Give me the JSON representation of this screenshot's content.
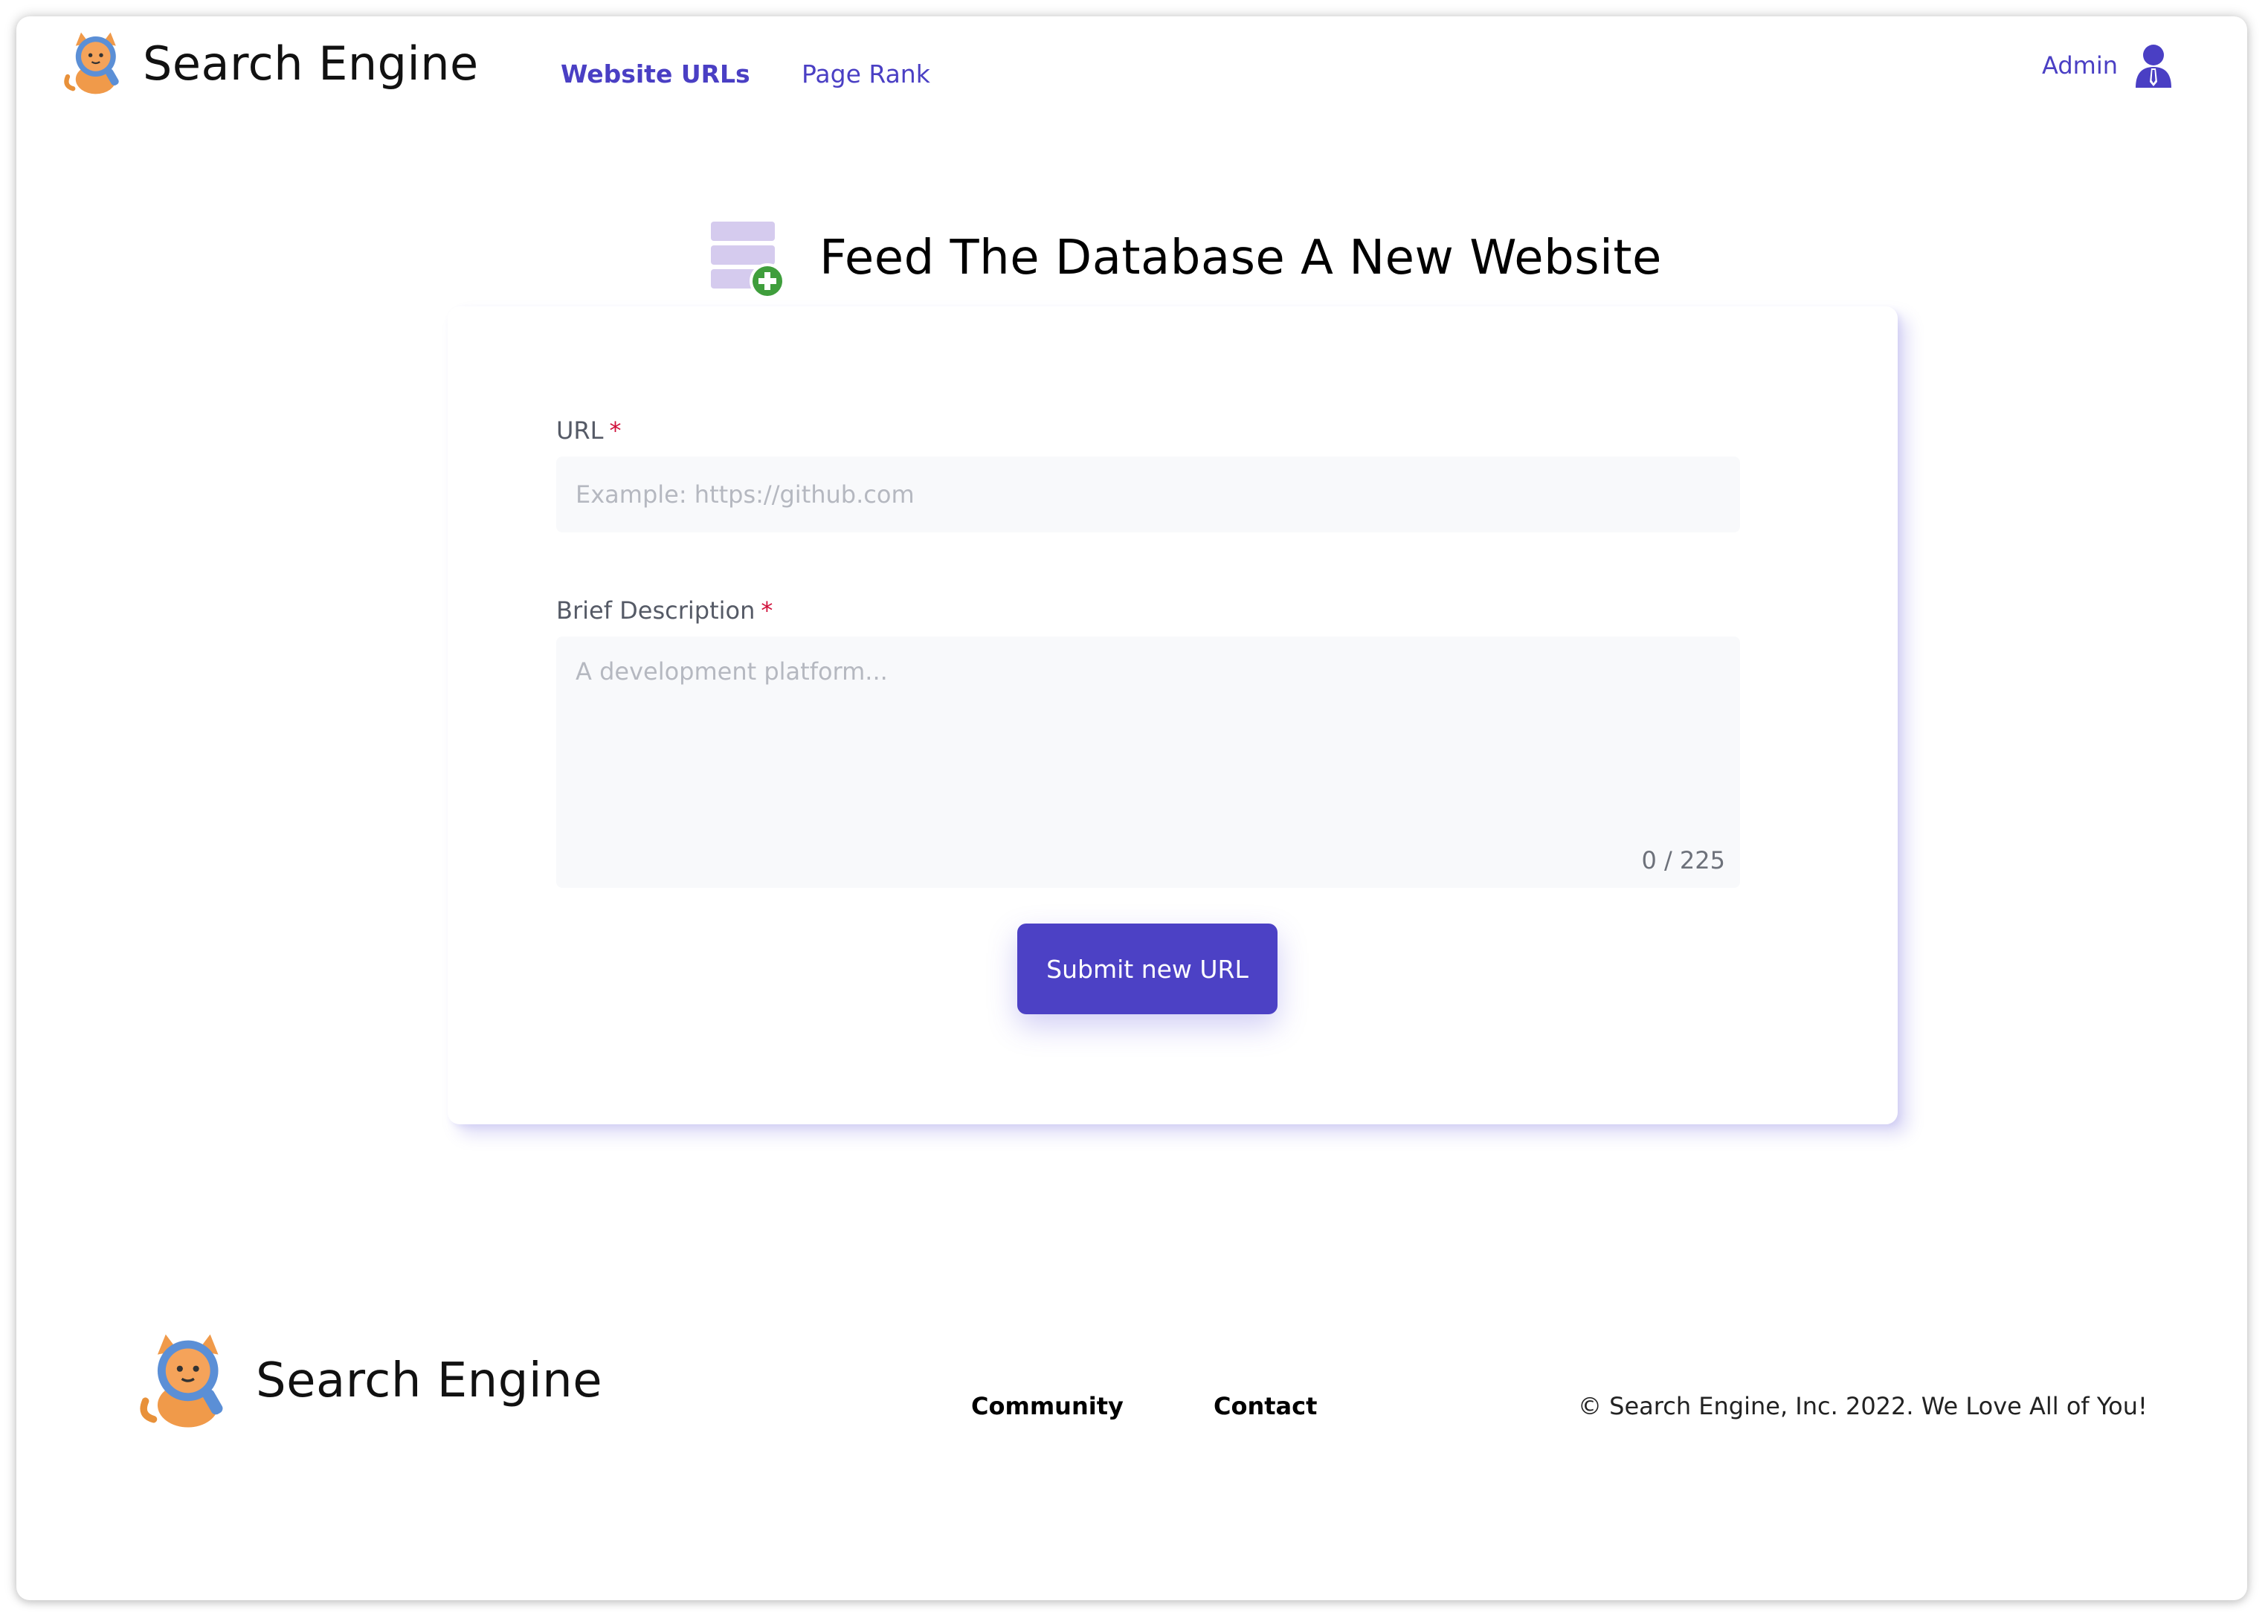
{
  "header": {
    "brand": "Search Engine",
    "nav": [
      {
        "label": "Website URLs",
        "active": true
      },
      {
        "label": "Page Rank",
        "active": false
      }
    ],
    "user": {
      "label": "Admin",
      "icon": "user-icon"
    }
  },
  "page": {
    "title": "Feed The Database A New Website",
    "title_icon": "database-add-icon"
  },
  "form": {
    "url": {
      "label": "URL",
      "required_mark": "*",
      "placeholder": "Example: https://github.com",
      "value": ""
    },
    "description": {
      "label": "Brief Description",
      "required_mark": "*",
      "placeholder": "A development platform...",
      "value": "",
      "counter": "0 / 225"
    },
    "submit_label": "Submit new URL"
  },
  "footer": {
    "brand": "Search Engine",
    "links": [
      "Community",
      "Contact"
    ],
    "copyright": "© Search Engine, Inc. 2022.  We Love All of You!"
  },
  "colors": {
    "accent": "#4c41c5",
    "nav_text": "#4a3fc4",
    "required": "#d0103a",
    "input_bg": "#f8f9fb",
    "db_icon": "#d5cbee",
    "plus_badge": "#3f9e3c"
  }
}
